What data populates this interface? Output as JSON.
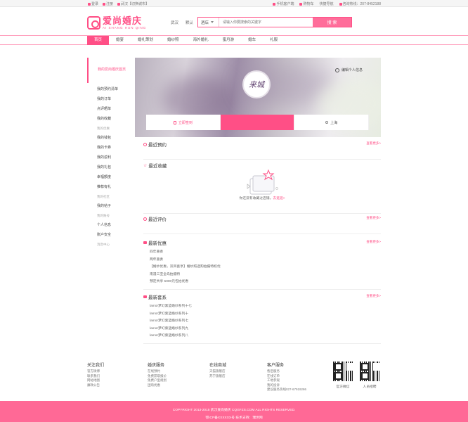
{
  "topbar": {
    "login": "登录",
    "register": "注册",
    "city": "武汉【切换城市】",
    "mobile": "手机客户端",
    "cart": "购物车",
    "quicknav": "快捷导航",
    "phone": "咨询热线：207-8452188"
  },
  "logo": {
    "cn": "爱尚婚庆",
    "en": "AI SHANG HUN QING"
  },
  "cities": [
    "武汉",
    "默认"
  ],
  "search": {
    "category": "酒店",
    "placeholder": "请输入你要搜索的关键字",
    "button": "搜 索"
  },
  "nav": {
    "items": [
      "首页",
      "婚宴",
      "婚礼策划",
      "婚纱照",
      "海外婚礼",
      "蜜月游",
      "婚车",
      "礼服"
    ]
  },
  "sidebar": {
    "first": "我的爱尚婚庆首页",
    "group1": [
      "我的预约清单",
      "我的订单",
      "点评晒单",
      "我的收藏"
    ],
    "group2_title": "我的优惠",
    "group2": [
      "我的钱包",
      "我的卡券",
      "我的返利",
      "我的礼包",
      "幸福额度",
      "推荐有礼"
    ],
    "group3_title": "我的社区",
    "group3": [
      "我的帖子"
    ],
    "group4_title": "我的账号",
    "group4": [
      "个人信息",
      "账户安全"
    ],
    "extra": "消息中心"
  },
  "profile": {
    "edit": "编辑个人信息",
    "avatar_text": "来城",
    "tab_sign": "立即签到",
    "tab_city": "上海"
  },
  "sections": {
    "booking": {
      "title": "最近预约",
      "more": "查看更多>"
    },
    "fav": {
      "title": "最近收藏",
      "empty": "你还没有收藏过店铺，",
      "empty_link": "去逛逛>"
    },
    "review": {
      "title": "最近评价",
      "more": "查看更多>"
    },
    "promo": {
      "title": "最新优惠",
      "more": "查看更多>",
      "items": [
        "四年重奏",
        "两年重奏",
        "【婚纱优惠，双目喜享】婚纱照选购拍摄特权优",
        "南漫三亚全岛拍摄特",
        "预定共享 5000元包拍优惠"
      ]
    },
    "sets": {
      "title": "最新套系",
      "more": "查看更多>",
      "items": [
        "lamor梦幻紫蓝婚纱系列十七",
        "lamor梦幻紫蓝婚纱系列十",
        "lamor梦幻紫蓝婚纱系列七",
        "lamor梦幻紫蓝婚纱系列九",
        "lamor梦幻紫蓝婚纱系列八"
      ]
    }
  },
  "footer": {
    "cols": [
      {
        "title": "关注我们",
        "items": [
          "官方微博",
          "联系我们",
          "网站地图",
          "廉政公告"
        ]
      },
      {
        "title": "婚庆服务",
        "items": [
          "在线预约",
          "免费获取报价",
          "免费户型规划",
          "团购优惠"
        ]
      },
      {
        "title": "在线商城",
        "items": [
          "天猫旗舰店",
          "苏宁旗舰店"
        ]
      },
      {
        "title": "客户服务",
        "items": [
          "售后服务",
          "在线订单",
          "工地参观",
          "我的投诉",
          "建议服务热线027-67919286"
        ]
      }
    ],
    "qr1": "官方微信",
    "qr2": "人员招聘",
    "copyright": "COPYRIGHT  2013-2015 武汉爱尚婚庆 CQGFZS.COM ALL RIGHTS RESERVED.",
    "icp": "鄂ICP备XXXXXX号 技术支持：瑞世网"
  },
  "colors": {
    "accent": "#ff4f86",
    "footer": "#ff6996"
  }
}
